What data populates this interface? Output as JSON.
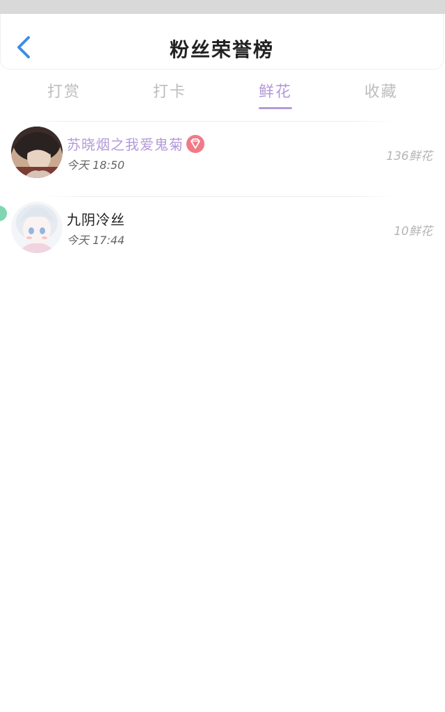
{
  "header": {
    "title": "粉丝荣誉榜",
    "back_icon": "chevron-left-icon",
    "accent_color": "#3a8ee6"
  },
  "tabs": [
    {
      "label": "打赏",
      "active": false
    },
    {
      "label": "打卡",
      "active": false
    },
    {
      "label": "鲜花",
      "active": true
    },
    {
      "label": "收藏",
      "active": false
    }
  ],
  "tab_active_color": "#b39ad8",
  "fans": [
    {
      "name": "苏晓烟之我爱鬼菊",
      "time": "今天 18:50",
      "amount": "136鲜花",
      "vip_icon": "diamond-icon",
      "name_color": "#b39ad8"
    },
    {
      "name": "九阴冷丝",
      "time": "今天 17:44",
      "amount": "10鲜花",
      "name_color": "#222222"
    }
  ]
}
